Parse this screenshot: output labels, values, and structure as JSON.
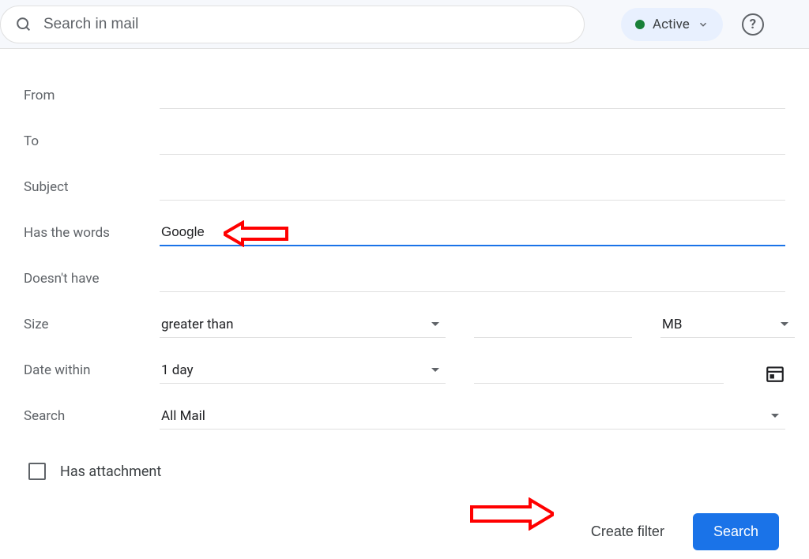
{
  "topbar": {
    "search_placeholder": "Search in mail",
    "status_label": "Active"
  },
  "form": {
    "from_label": "From",
    "from_value": "",
    "to_label": "To",
    "to_value": "",
    "subject_label": "Subject",
    "subject_value": "",
    "has_words_label": "Has the words",
    "has_words_value": "Google",
    "doesnt_have_label": "Doesn't have",
    "doesnt_have_value": "",
    "size_label": "Size",
    "size_comparison": "greater than",
    "size_unit": "MB",
    "date_label": "Date within",
    "date_range": "1 day",
    "search_label": "Search",
    "search_scope": "All Mail",
    "has_attachment_label": "Has attachment"
  },
  "footer": {
    "create_filter_label": "Create filter",
    "search_button_label": "Search"
  }
}
